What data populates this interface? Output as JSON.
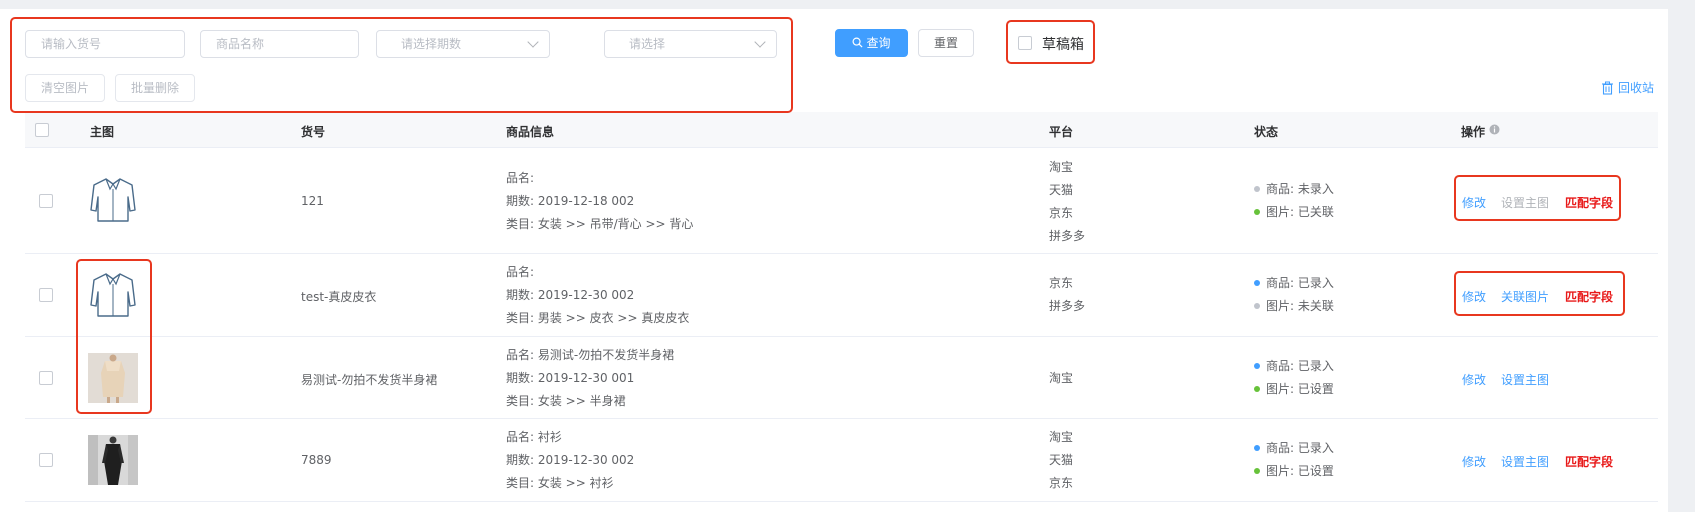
{
  "filters": {
    "item_no_placeholder": "请输入货号",
    "product_name_placeholder": "商品名称",
    "period_placeholder": "请选择期数",
    "select_placeholder": "请选择",
    "clear_images_label": "清空图片",
    "batch_delete_label": "批量删除"
  },
  "actions": {
    "query_label": "查询",
    "reset_label": "重置",
    "draft_label": "草稿箱",
    "recycle_label": "回收站"
  },
  "table": {
    "headers": [
      "主图",
      "货号",
      "商品信息",
      "平台",
      "状态",
      "操作"
    ],
    "rows": [
      {
        "image": "shirt-outline",
        "item_no": "121",
        "info": [
          "品名:",
          "期数: 2019-12-18 002",
          "类目: 女装 >> 吊带/背心 >> 背心"
        ],
        "platforms": [
          "淘宝",
          "天猫",
          "京东",
          "拼多多"
        ],
        "status": [
          {
            "text": "商品: 未录入",
            "color": "#c0c4cc"
          },
          {
            "text": "图片: 已关联",
            "color": "#67c23a"
          }
        ],
        "ops": [
          {
            "label": "修改",
            "style": "blue"
          },
          {
            "label": "设置主图",
            "style": "gray"
          },
          {
            "label": "匹配字段",
            "style": "red"
          }
        ]
      },
      {
        "image": "shirt-outline",
        "item_no": "test-真皮皮衣",
        "info": [
          "品名:",
          "期数: 2019-12-30 002",
          "类目: 男装 >> 皮衣 >> 真皮皮衣"
        ],
        "platforms": [
          "京东",
          "拼多多"
        ],
        "status": [
          {
            "text": "商品: 已录入",
            "color": "#409eff"
          },
          {
            "text": "图片: 未关联",
            "color": "#c0c4cc"
          }
        ],
        "ops": [
          {
            "label": "修改",
            "style": "blue"
          },
          {
            "label": "关联图片",
            "style": "blue"
          },
          {
            "label": "匹配字段",
            "style": "red"
          }
        ]
      },
      {
        "image": "photo-beige-dress",
        "item_no": "易测试-勿拍不发货半身裙",
        "info": [
          "品名: 易测试-勿拍不发货半身裙",
          "期数: 2019-12-30 001",
          "类目: 女装 >> 半身裙"
        ],
        "platforms": [
          "淘宝"
        ],
        "status": [
          {
            "text": "商品: 已录入",
            "color": "#409eff"
          },
          {
            "text": "图片: 已设置",
            "color": "#67c23a"
          }
        ],
        "ops": [
          {
            "label": "修改",
            "style": "blue"
          },
          {
            "label": "设置主图",
            "style": "blue"
          }
        ]
      },
      {
        "image": "photo-dark-outfit",
        "item_no": "7889",
        "info": [
          "品名: 衬衫",
          "期数: 2019-12-30 002",
          "类目: 女装 >> 衬衫"
        ],
        "platforms": [
          "淘宝",
          "天猫",
          "京东"
        ],
        "status": [
          {
            "text": "商品: 已录入",
            "color": "#409eff"
          },
          {
            "text": "图片: 已设置",
            "color": "#67c23a"
          }
        ],
        "ops": [
          {
            "label": "修改",
            "style": "blue"
          },
          {
            "label": "设置主图",
            "style": "blue"
          },
          {
            "label": "匹配字段",
            "style": "red"
          }
        ]
      }
    ]
  },
  "colors": {
    "primary": "#409eff",
    "danger": "#e81919",
    "annotation": "#e8371f"
  }
}
